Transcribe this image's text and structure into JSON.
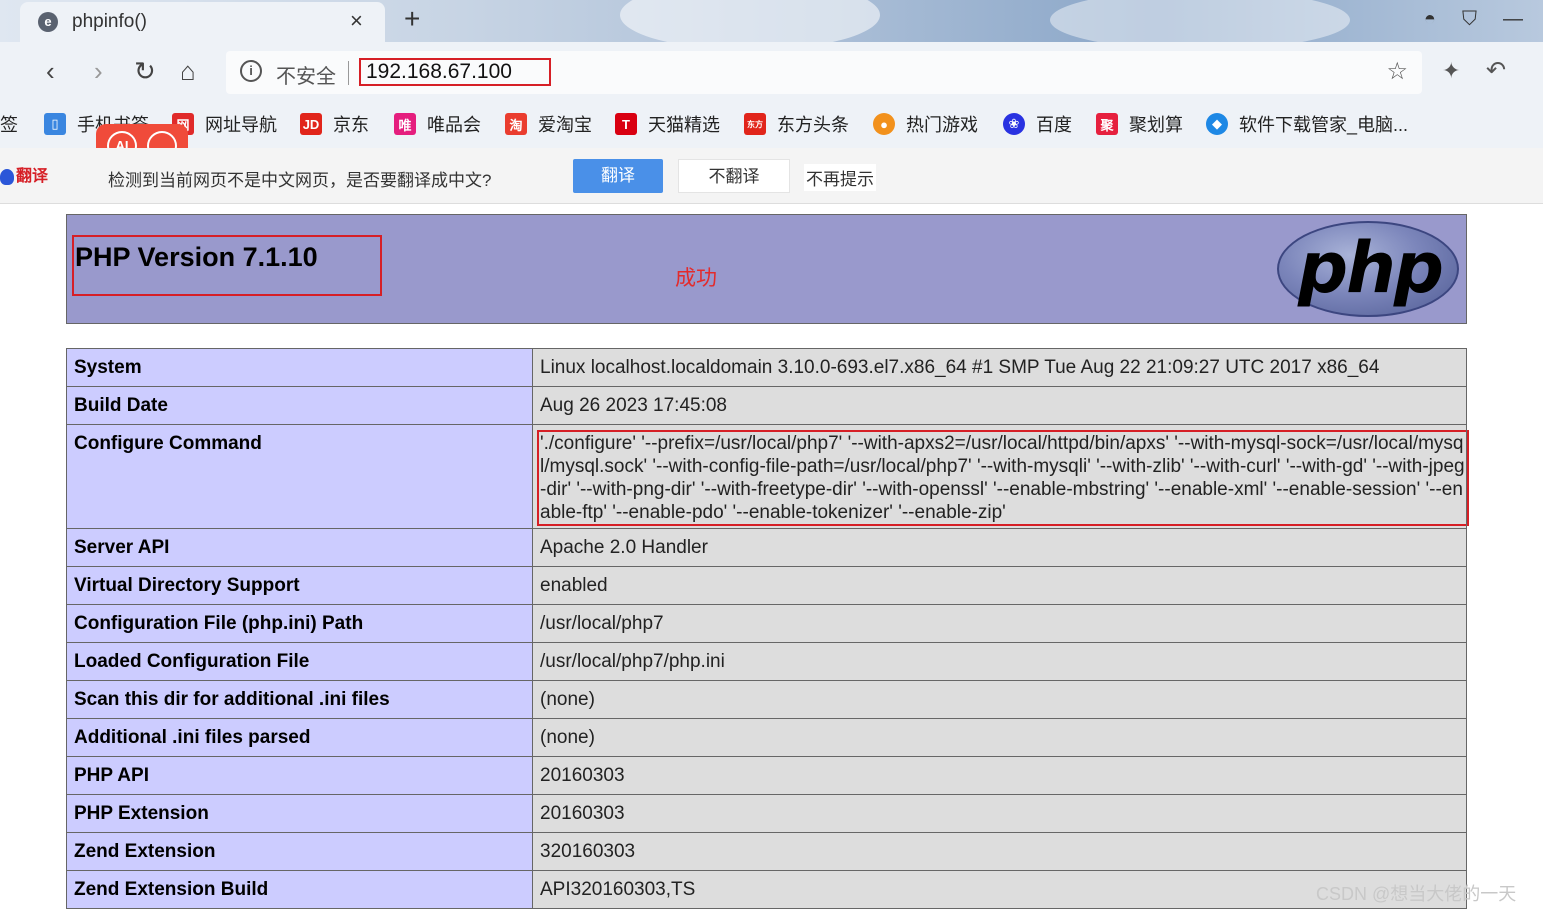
{
  "tab": {
    "title": "phpinfo()",
    "close": "×",
    "new_tab": "+"
  },
  "address": {
    "security": "不安全",
    "url": "192.168.67.100"
  },
  "bookmarks": [
    {
      "label": "签",
      "icon_color": "#eef2f7"
    },
    {
      "label": "手机书签",
      "icon_color": "#3a86e0"
    },
    {
      "label": "网址导航",
      "icon_color": "#e02a2a"
    },
    {
      "label": "京东",
      "icon_color": "#e1251b"
    },
    {
      "label": "唯品会",
      "icon_color": "#e51e7e"
    },
    {
      "label": "爱淘宝",
      "icon_color": "#ea3d2f"
    },
    {
      "label": "天猫精选",
      "icon_color": "#d90011"
    },
    {
      "label": "东方头条",
      "icon_color": "#e1251b"
    },
    {
      "label": "热门游戏",
      "icon_color": "#f2911c"
    },
    {
      "label": "百度",
      "icon_color": "#2932e1"
    },
    {
      "label": "聚划算",
      "icon_color": "#e6203e"
    },
    {
      "label": "软件下载管家_电脑...",
      "icon_color": "#1e88e5"
    }
  ],
  "translate": {
    "logo": "翻译",
    "prompt": "检测到当前网页不是中文网页，是否要翻译成中文?",
    "translate_button": "翻译",
    "no_translate_button": "不翻译",
    "never_button": "不再提示"
  },
  "php": {
    "title": "PHP Version 7.1.10",
    "note": "成功",
    "logo_text": "php"
  },
  "info_rows": [
    {
      "key": "System",
      "value": "Linux localhost.localdomain 3.10.0-693.el7.x86_64 #1 SMP Tue Aug 22 21:09:27 UTC 2017 x86_64"
    },
    {
      "key": "Build Date",
      "value": "Aug 26 2023 17:45:08"
    },
    {
      "key": "Configure Command",
      "value": "'./configure' '--prefix=/usr/local/php7' '--with-apxs2=/usr/local/httpd/bin/apxs' '--with-mysql-sock=/usr/local/mysql/mysql.sock' '--with-config-file-path=/usr/local/php7' '--with-mysqli' '--with-zlib' '--with-curl' '--with-gd' '--with-jpeg-dir' '--with-png-dir' '--with-freetype-dir' '--with-openssl' '--enable-mbstring' '--enable-xml' '--enable-session' '--enable-ftp' '--enable-pdo' '--enable-tokenizer' '--enable-zip'"
    },
    {
      "key": "Server API",
      "value": "Apache 2.0 Handler"
    },
    {
      "key": "Virtual Directory Support",
      "value": "enabled"
    },
    {
      "key": "Configuration File (php.ini) Path",
      "value": "/usr/local/php7"
    },
    {
      "key": "Loaded Configuration File",
      "value": "/usr/local/php7/php.ini"
    },
    {
      "key": "Scan this dir for additional .ini files",
      "value": "(none)"
    },
    {
      "key": "Additional .ini files parsed",
      "value": "(none)"
    },
    {
      "key": "PHP API",
      "value": "20160303"
    },
    {
      "key": "PHP Extension",
      "value": "20160303"
    },
    {
      "key": "Zend Extension",
      "value": "320160303"
    },
    {
      "key": "Zend Extension Build",
      "value": "API320160303,TS"
    }
  ],
  "watermark": "CSDN @想当大佬的一天"
}
